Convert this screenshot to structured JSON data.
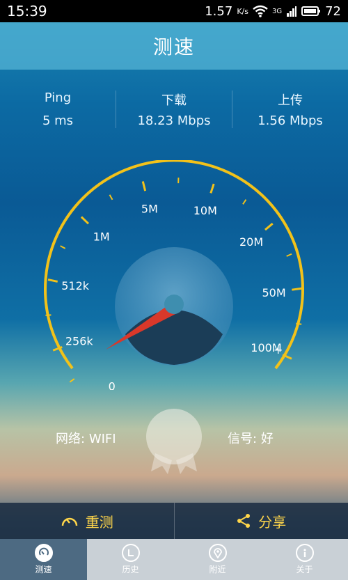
{
  "status_bar": {
    "time": "15:39",
    "speed": "1.57",
    "speed_unit": "K/s",
    "network": "3G",
    "battery": "72"
  },
  "header": {
    "title": "测速"
  },
  "stats": {
    "ping": {
      "label": "Ping",
      "value": "5 ms"
    },
    "download": {
      "label": "下载",
      "value": "18.23 Mbps"
    },
    "upload": {
      "label": "上传",
      "value": "1.56 Mbps"
    }
  },
  "gauge": {
    "labels": [
      "0",
      "256k",
      "512k",
      "1M",
      "5M",
      "10M",
      "20M",
      "50M",
      "100M"
    ],
    "plus": "+",
    "needle_fraction": 0.02
  },
  "network": {
    "label": "网络:",
    "value": "WIFI",
    "signal_label": "信号:",
    "signal_value": "好"
  },
  "actions": {
    "retest": "重测",
    "share": "分享"
  },
  "tabs": [
    "测速",
    "历史",
    "附近",
    "关于"
  ],
  "colors": {
    "gauge": "#f2c21a",
    "needle": "#d9382a",
    "accent": "#ffd64a"
  }
}
